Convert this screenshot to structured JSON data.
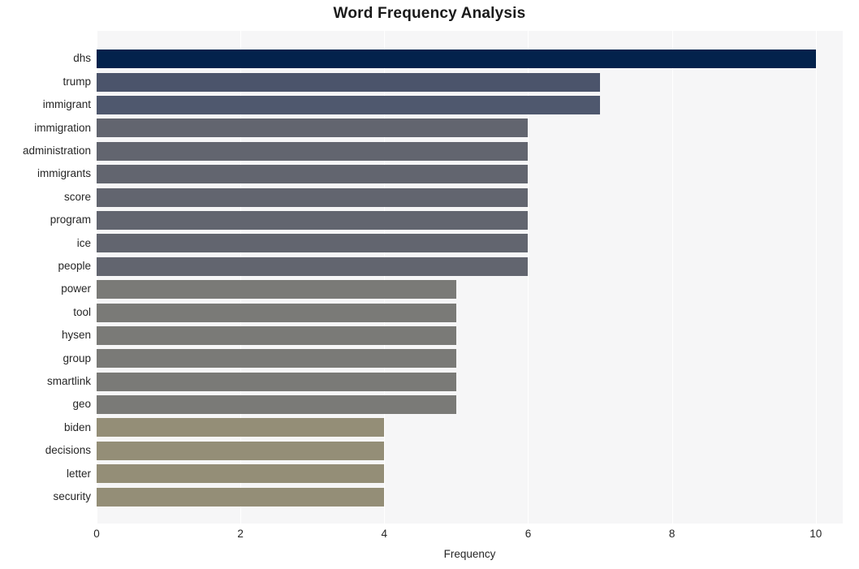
{
  "chart_data": {
    "type": "bar",
    "orientation": "horizontal",
    "title": "Word Frequency Analysis",
    "xlabel": "Frequency",
    "ylabel": "",
    "categories": [
      "dhs",
      "trump",
      "immigrant",
      "immigration",
      "administration",
      "immigrants",
      "score",
      "program",
      "ice",
      "people",
      "power",
      "tool",
      "hysen",
      "group",
      "smartlink",
      "geo",
      "biden",
      "decisions",
      "letter",
      "security"
    ],
    "values": [
      10,
      7,
      7,
      6,
      6,
      6,
      6,
      6,
      6,
      6,
      5,
      5,
      5,
      5,
      5,
      5,
      4,
      4,
      4,
      4
    ],
    "xlim": [
      0,
      10.375
    ],
    "xticks": [
      0,
      2,
      4,
      6,
      8,
      10
    ],
    "xtick_labels": [
      "0",
      "2",
      "4",
      "6",
      "8",
      "10"
    ],
    "grid": true,
    "grid_color": "#ffffff",
    "plot_background": "#f6f6f7",
    "figure_background": "#ffffff",
    "legend": null,
    "bar_colors": [
      "#03224c",
      "#4b546b",
      "#4f586e",
      "#62656f",
      "#62656f",
      "#62656f",
      "#62656f",
      "#62656f",
      "#62656f",
      "#62656f",
      "#7a7a77",
      "#7a7a77",
      "#7a7a77",
      "#7a7a77",
      "#7a7a77",
      "#7a7a77",
      "#948e77",
      "#948e77",
      "#948e77",
      "#948e77"
    ]
  }
}
